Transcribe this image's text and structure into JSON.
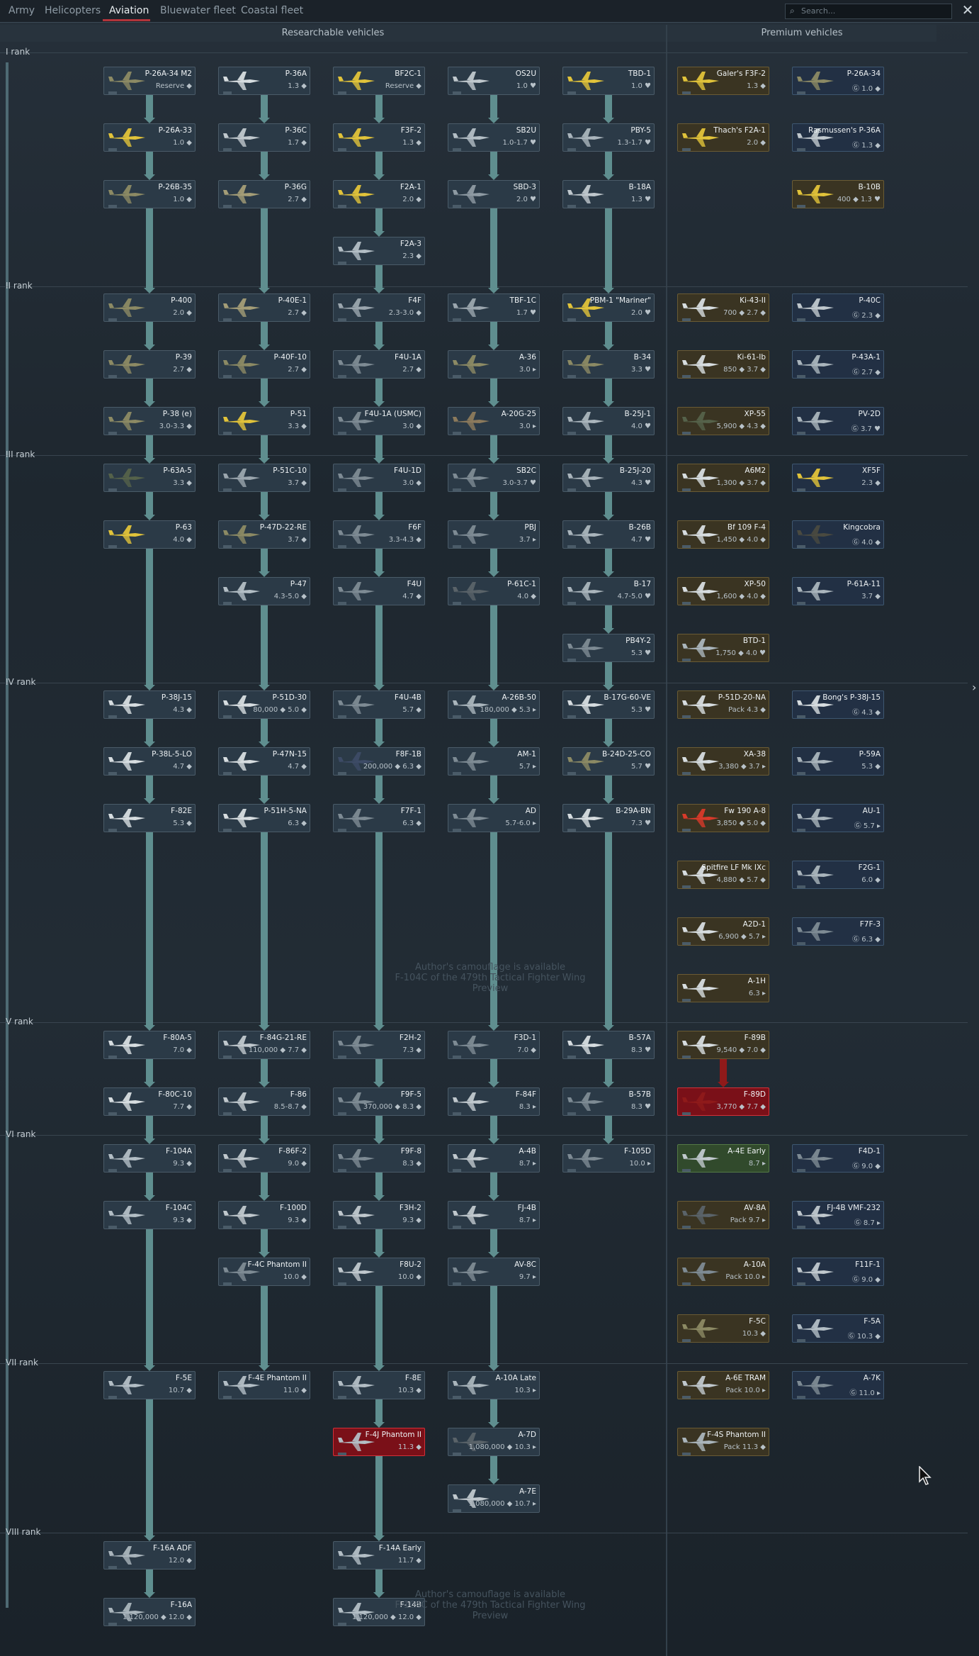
{
  "nav": {
    "tabs": [
      "Army",
      "Helicopters",
      "Aviation",
      "Bluewater fleet",
      "Coastal fleet"
    ],
    "active": "Aviation",
    "search_placeholder": "Search..."
  },
  "headers": {
    "researchable": "Researchable vehicles",
    "premium": "Premium vehicles"
  },
  "ranks": [
    "I rank",
    "II rank",
    "III rank",
    "IV rank",
    "V rank",
    "VI rank",
    "VII rank",
    "VIII rank"
  ],
  "watermark": {
    "line1": "Author's camouflage is available",
    "line2": "F-104C of the 479th Tactical Fighter Wing",
    "preview": "Preview"
  },
  "watermark2": {
    "line1": "Author's camouflage is available",
    "line2": "F-104C of the 479th Tactical Fighter Wing",
    "preview": "Preview"
  },
  "vehicles": [
    {
      "name": "P-26A-34 M2",
      "br": "Reserve ◆",
      "c": "#8c8a64"
    },
    {
      "name": "P-36A",
      "br": "1.3 ◆",
      "c": "#d7dde0"
    },
    {
      "name": "BF2C-1",
      "br": "Reserve ◆",
      "c": "#e1c33a"
    },
    {
      "name": "OS2U",
      "br": "1.0 ♥",
      "c": "#c0c8cd"
    },
    {
      "name": "TBD-1",
      "br": "1.0 ♥",
      "c": "#e1c33a"
    },
    {
      "name": "P-26A-33",
      "br": "1.0 ◆",
      "c": "#e1c33a"
    },
    {
      "name": "P-36C",
      "br": "1.7 ◆",
      "c": "#c0c8cd"
    },
    {
      "name": "F3F-2",
      "br": "1.3 ◆",
      "c": "#e1c33a"
    },
    {
      "name": "SB2U",
      "br": "1.0-1.7 ♥",
      "c": "#b3bec5"
    },
    {
      "name": "PBY-5",
      "br": "1.3-1.7 ♥",
      "c": "#aab5bc"
    },
    {
      "name": "P-26B-35",
      "br": "1.0 ◆",
      "c": "#8c8a64"
    },
    {
      "name": "P-36G",
      "br": "2.7 ◆",
      "c": "#a49d77"
    },
    {
      "name": "F2A-1",
      "br": "2.0 ◆",
      "c": "#e1c33a"
    },
    {
      "name": "SBD-3",
      "br": "2.0 ♥",
      "c": "#8e9aa3"
    },
    {
      "name": "B-18A",
      "br": "1.3 ♥",
      "c": "#c0c8cd"
    },
    {
      "name": "F2A-3",
      "br": "2.3 ◆",
      "c": "#b3bec5"
    },
    {
      "name": "P-400",
      "br": "2.0 ◆",
      "c": "#8c8a64"
    },
    {
      "name": "P-40E-1",
      "br": "2.7 ◆",
      "c": "#a49d77"
    },
    {
      "name": "F4F",
      "br": "2.3-3.0 ◆",
      "c": "#9ba6ae"
    },
    {
      "name": "TBF-1C",
      "br": "1.7 ♥",
      "c": "#9ba6ae"
    },
    {
      "name": "PBM-1 \"Mariner\"",
      "br": "2.0 ♥",
      "c": "#e1c33a"
    },
    {
      "name": "P-39",
      "br": "2.7 ◆",
      "c": "#8c8a64"
    },
    {
      "name": "P-40F-10",
      "br": "2.7 ◆",
      "c": "#8c8a64"
    },
    {
      "name": "F4U-1A",
      "br": "2.7 ◆",
      "c": "#7e8b94"
    },
    {
      "name": "A-36",
      "br": "3.0 ▸",
      "c": "#8c8a64"
    },
    {
      "name": "B-34",
      "br": "3.3 ♥",
      "c": "#8c8a64"
    },
    {
      "name": "P-38 (e)",
      "br": "3.0-3.3 ◆",
      "c": "#8c8a64"
    },
    {
      "name": "P-51",
      "br": "3.3 ◆",
      "c": "#e1c33a"
    },
    {
      "name": "F4U-1A (USMC)",
      "br": "3.0 ◆",
      "c": "#7e8b94"
    },
    {
      "name": "A-20G-25",
      "br": "3.0 ▸",
      "c": "#8c7a5c"
    },
    {
      "name": "B-25J-1",
      "br": "4.0 ♥",
      "c": "#aab5bc"
    },
    {
      "name": "P-63A-5",
      "br": "3.3 ◆",
      "c": "#55624a"
    },
    {
      "name": "P-51C-10",
      "br": "3.7 ◆",
      "c": "#9ba6ae"
    },
    {
      "name": "F4U-1D",
      "br": "3.0 ◆",
      "c": "#7e8b94"
    },
    {
      "name": "SB2C",
      "br": "3.0-3.7 ♥",
      "c": "#7e8b94"
    },
    {
      "name": "B-25J-20",
      "br": "4.3 ♥",
      "c": "#aab5bc"
    },
    {
      "name": "P-63",
      "br": "4.0 ◆",
      "c": "#e1c33a"
    },
    {
      "name": "P-47D-22-RE",
      "br": "3.7 ◆",
      "c": "#8c8a64"
    },
    {
      "name": "F6F",
      "br": "3.3-4.3 ◆",
      "c": "#7e8b94"
    },
    {
      "name": "PBJ",
      "br": "3.7 ▸",
      "c": "#7e8b94"
    },
    {
      "name": "B-26B",
      "br": "4.7 ♥",
      "c": "#aab5bc"
    },
    {
      "name": "P-47",
      "br": "4.3-5.0 ◆",
      "c": "#b3bec5"
    },
    {
      "name": "F4U",
      "br": "4.7 ◆",
      "c": "#7e8b94"
    },
    {
      "name": "P-61C-1",
      "br": "4.0 ◆",
      "c": "#5a6369"
    },
    {
      "name": "B-17",
      "br": "4.7-5.0 ♥",
      "c": "#aab5bc"
    },
    {
      "name": "PB4Y-2",
      "br": "5.3 ♥",
      "c": "#7e8b94"
    },
    {
      "name": "P-38J-15",
      "br": "4.3 ◆",
      "c": "#d7dde0"
    },
    {
      "name": "P-51D-30",
      "br": "80,000 ◆ 5.0 ◆",
      "c": "#d7dde0"
    },
    {
      "name": "F4U-4B",
      "br": "5.7 ◆",
      "c": "#7e8b94"
    },
    {
      "name": "A-26B-50",
      "br": "180,000 ◆ 5.3 ▸",
      "c": "#aab5bc"
    },
    {
      "name": "B-17G-60-VE",
      "br": "5.3 ♥",
      "c": "#d7dde0"
    },
    {
      "name": "P-38L-5-LO",
      "br": "4.7 ◆",
      "c": "#d7dde0"
    },
    {
      "name": "P-47N-15",
      "br": "4.7 ◆",
      "c": "#d7dde0"
    },
    {
      "name": "F8F-1B",
      "br": "200,000 ◆ 6.3 ◆",
      "c": "#3d4b66"
    },
    {
      "name": "AM-1",
      "br": "5.7 ▸",
      "c": "#7e8b94"
    },
    {
      "name": "B-24D-25-CO",
      "br": "5.7 ♥",
      "c": "#8c8a64"
    },
    {
      "name": "F-82E",
      "br": "5.3 ◆",
      "c": "#d7dde0"
    },
    {
      "name": "P-51H-5-NA",
      "br": "6.3 ◆",
      "c": "#d7dde0"
    },
    {
      "name": "F7F-1",
      "br": "6.3 ◆",
      "c": "#7e8b94"
    },
    {
      "name": "AD",
      "br": "5.7-6.0 ▸",
      "c": "#7e8b94"
    },
    {
      "name": "B-29A-BN",
      "br": "7.3 ♥",
      "c": "#d7dde0"
    },
    {
      "name": "F-80A-5",
      "br": "7.0 ◆",
      "c": "#d7dde0"
    },
    {
      "name": "F-84G-21-RE",
      "br": "110,000 ◆ 7.7 ◆",
      "c": "#c0c8cd"
    },
    {
      "name": "F2H-2",
      "br": "7.3 ◆",
      "c": "#7e8b94"
    },
    {
      "name": "F3D-1",
      "br": "7.0 ◆",
      "c": "#7e8b94"
    },
    {
      "name": "B-57A",
      "br": "8.3 ♥",
      "c": "#d7dde0"
    },
    {
      "name": "F-80C-10",
      "br": "7.7 ◆",
      "c": "#d7dde0"
    },
    {
      "name": "F-86",
      "br": "8.5-8.7 ◆",
      "c": "#c0c8cd"
    },
    {
      "name": "F9F-5",
      "br": "370,000 ◆ 8.3 ◆",
      "c": "#7e8b94"
    },
    {
      "name": "F-84F",
      "br": "8.3 ▸",
      "c": "#c0c8cd"
    },
    {
      "name": "B-57B",
      "br": "8.3 ♥",
      "c": "#7e8b94"
    },
    {
      "name": "F-104A",
      "br": "9.3 ◆",
      "c": "#b3bec5"
    },
    {
      "name": "F-86F-2",
      "br": "9.0 ◆",
      "c": "#c0c8cd"
    },
    {
      "name": "F9F-8",
      "br": "8.3 ◆",
      "c": "#7e8b94"
    },
    {
      "name": "A-4B",
      "br": "8.7 ▸",
      "c": "#c0c8cd"
    },
    {
      "name": "F-105D",
      "br": "10.0 ▸",
      "c": "#7e8b94"
    },
    {
      "name": "F-104C",
      "br": "9.3 ◆",
      "c": "#b3bec5"
    },
    {
      "name": "F-100D",
      "br": "9.3 ◆",
      "c": "#c0c8cd"
    },
    {
      "name": "F3H-2",
      "br": "9.3 ◆",
      "c": "#c0c8cd"
    },
    {
      "name": "FJ-4B",
      "br": "8.7 ▸",
      "c": "#c0c8cd"
    },
    {
      "name": "F-4C Phantom II",
      "br": "10.0 ◆",
      "c": "#7e8b94"
    },
    {
      "name": "F8U-2",
      "br": "10.0 ◆",
      "c": "#c0c8cd"
    },
    {
      "name": "AV-8C",
      "br": "9.7 ▸",
      "c": "#7e8b94"
    },
    {
      "name": "F-5E",
      "br": "10.7 ◆",
      "c": "#b3bec5"
    },
    {
      "name": "F-4E Phantom II",
      "br": "11.0 ◆",
      "c": "#b3bec5"
    },
    {
      "name": "F-8E",
      "br": "10.3 ◆",
      "c": "#b3bec5"
    },
    {
      "name": "A-10A Late",
      "br": "10.3 ▸",
      "c": "#aab5bc"
    },
    {
      "name": "F-4J Phantom II",
      "br": "11.3 ◆",
      "c": "#b3bec5"
    },
    {
      "name": "A-7D",
      "br": "1,080,000 ◆ 10.3 ▸",
      "c": "#5a6369"
    },
    {
      "name": "A-7E",
      "br": "1,080,000 ◆ 10.7 ▸",
      "c": "#c0c8cd"
    },
    {
      "name": "F-16A ADF",
      "br": "12.0 ◆",
      "c": "#aab5bc"
    },
    {
      "name": "F-14A Early",
      "br": "11.7 ◆",
      "c": "#b3bec5"
    },
    {
      "name": "F-16A",
      "br": "1,120,000 ◆ 12.0 ◆",
      "c": "#aab5bc"
    },
    {
      "name": "F-14B",
      "br": "1,120,000 ◆ 12.0 ◆",
      "c": "#b3bec5"
    }
  ],
  "premium": [
    {
      "name": "Galer's F3F-2",
      "br": "1.3 ◆",
      "c": "#e1c33a"
    },
    {
      "name": "P-26A-34",
      "br": "Ⓖ 1.0 ◆",
      "c": "#8c8a64"
    },
    {
      "name": "Thach's F2A-1",
      "br": "2.0 ◆",
      "c": "#e1c33a"
    },
    {
      "name": "Rasmussen's P-36A",
      "br": "Ⓖ 1.3 ◆",
      "c": "#c0c8cd"
    },
    {
      "name": "B-10B",
      "br": "400 ◆ 1.3 ♥",
      "c": "#e1c33a"
    },
    {
      "name": "Ki-43-II",
      "br": "700 ◆ 2.7 ◆",
      "c": "#d7dde0"
    },
    {
      "name": "P-40C",
      "br": "Ⓖ 2.3 ◆",
      "c": "#c0c8cd"
    },
    {
      "name": "Ki-61-Ib",
      "br": "850 ◆ 3.7 ◆",
      "c": "#d7dde0"
    },
    {
      "name": "P-43A-1",
      "br": "Ⓖ 2.7 ◆",
      "c": "#aab5bc"
    },
    {
      "name": "XP-55",
      "br": "5,900 ◆ 4.3 ◆",
      "c": "#55624a"
    },
    {
      "name": "PV-2D",
      "br": "Ⓖ 3.7 ♥",
      "c": "#aab5bc"
    },
    {
      "name": "A6M2",
      "br": "1,300 ◆ 3.7 ◆",
      "c": "#d7dde0"
    },
    {
      "name": "XF5F",
      "br": "2.3 ◆",
      "c": "#e1c33a"
    },
    {
      "name": "Bf 109 F-4",
      "br": "1,450 ◆ 4.0 ◆",
      "c": "#d7dde0"
    },
    {
      "name": "Kingcobra",
      "br": "Ⓖ 4.0 ◆",
      "c": "#4a4a40"
    },
    {
      "name": "XP-50",
      "br": "1,600 ◆ 4.0 ◆",
      "c": "#d7dde0"
    },
    {
      "name": "P-61A-11",
      "br": "3.7 ◆",
      "c": "#aab5bc"
    },
    {
      "name": "BTD-1",
      "br": "1,750 ◆ 4.0 ♥",
      "c": "#aab5bc"
    },
    {
      "name": "P-51D-20-NA",
      "br": "Pack 4.3 ◆",
      "c": "#d7dde0"
    },
    {
      "name": "Bong's P-38J-15",
      "br": "Ⓖ 4.3 ◆",
      "c": "#d7dde0"
    },
    {
      "name": "XA-38",
      "br": "3,380 ◆ 3.7 ▸",
      "c": "#d7dde0"
    },
    {
      "name": "P-59A",
      "br": "5.3 ◆",
      "c": "#aab5bc"
    },
    {
      "name": "Fw 190 A-8",
      "br": "3,850 ◆ 5.0 ◆",
      "c": "#d83a2a"
    },
    {
      "name": "AU-1",
      "br": "Ⓖ 5.7 ▸",
      "c": "#aab5bc"
    },
    {
      "name": "Spitfire LF Mk IXc",
      "br": "4,880 ◆ 5.7 ◆",
      "c": "#d7dde0"
    },
    {
      "name": "F2G-1",
      "br": "6.0 ◆",
      "c": "#aab5bc"
    },
    {
      "name": "A2D-1",
      "br": "6,900 ◆ 5.7 ▸",
      "c": "#d7dde0"
    },
    {
      "name": "F7F-3",
      "br": "Ⓖ 6.3 ◆",
      "c": "#7e8b94"
    },
    {
      "name": "A-1H",
      "br": "6.3 ▸",
      "c": "#d7dde0"
    },
    {
      "name": "F-89B",
      "br": "9,540 ◆ 7.0 ◆",
      "c": "#d7dde0"
    },
    {
      "name": "F-89D",
      "br": "3,770 ◆ 7.7 ◆",
      "c": "#8f1a1a"
    },
    {
      "name": "A-4E Early",
      "br": "8.7 ▸",
      "c": "#c0c8cd"
    },
    {
      "name": "F4D-1",
      "br": "Ⓖ 9.0 ◆",
      "c": "#7e8b94"
    },
    {
      "name": "AV-8A",
      "br": "Pack 9.7 ▸",
      "c": "#5a6369"
    },
    {
      "name": "FJ-4B VMF-232",
      "br": "Ⓖ 8.7 ▸",
      "c": "#c0c8cd"
    },
    {
      "name": "A-10A",
      "br": "Pack 10.0 ▸",
      "c": "#7e8b94"
    },
    {
      "name": "F11F-1",
      "br": "Ⓖ 9.0 ◆",
      "c": "#c0c8cd"
    },
    {
      "name": "F-5C",
      "br": "10.3 ◆",
      "c": "#8c8a64"
    },
    {
      "name": "F-5A",
      "br": "Ⓖ 10.3 ◆",
      "c": "#b3bec5"
    },
    {
      "name": "A-6E TRAM",
      "br": "Pack 10.0 ▸",
      "c": "#c0c8cd"
    },
    {
      "name": "A-7K",
      "br": "Ⓖ 11.0 ▸",
      "c": "#7e8b94"
    },
    {
      "name": "F-4S Phantom II",
      "br": "Pack 11.3 ◆",
      "c": "#aab5bc"
    }
  ],
  "colors": {
    "accent": "#b2343a",
    "tree_line": "#5f8e8f",
    "premium_bg": "#3a3422",
    "squadron_red": "#7a1018"
  }
}
